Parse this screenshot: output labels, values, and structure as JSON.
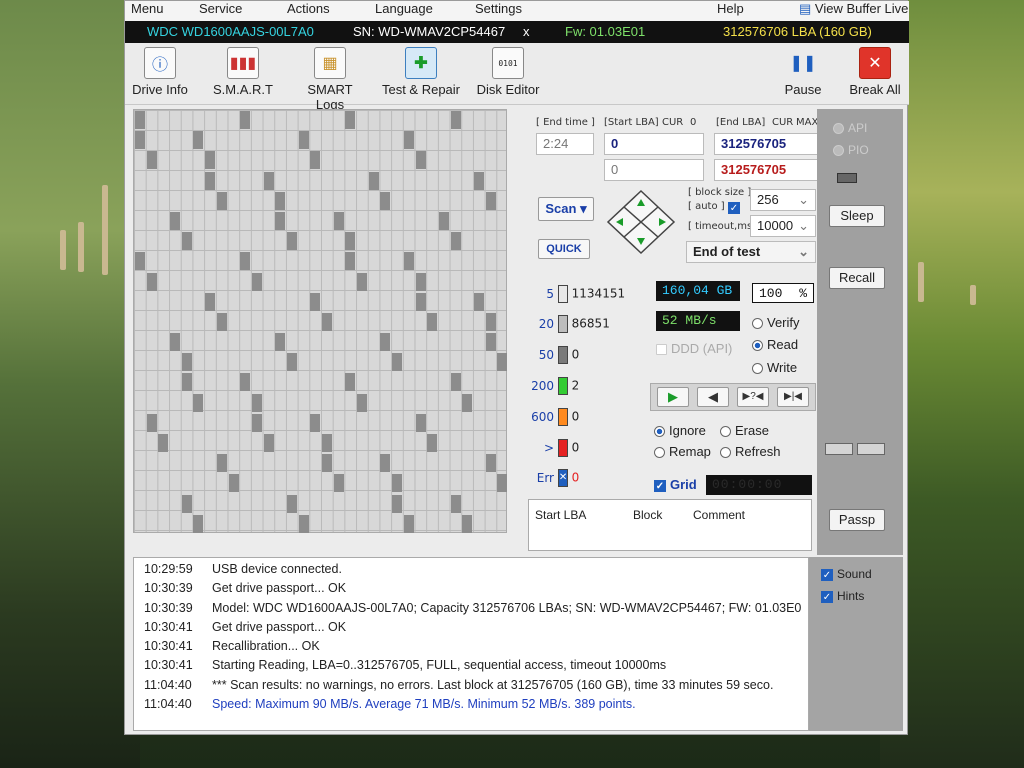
{
  "menu": {
    "items": [
      "Menu",
      "Service",
      "Actions",
      "Language",
      "Settings",
      "Help"
    ],
    "view_buffer": "View Buffer Live"
  },
  "drive": {
    "model": "WDC WD1600AAJS-00L7A0",
    "serial": "SN: WD-WMAV2CP54467",
    "close": "x",
    "firmware": "Fw: 01.03E01",
    "capacity": "312576706 LBA (160 GB)"
  },
  "toolbar": {
    "drive_info": "Drive Info",
    "smart": "S.M.A.R.T",
    "smart_logs": "SMART Logs",
    "test_repair": "Test & Repair",
    "disk_editor": "Disk Editor",
    "pause": "Pause",
    "break_all": "Break All"
  },
  "controls": {
    "end_time_label": "[ End time ]",
    "end_time_value": "2:24",
    "start_lba_label": "[Start LBA]",
    "cur_label": "CUR",
    "cur_value": "0",
    "end_lba_label": "[End LBA]",
    "cur2_label": "CUR",
    "max_label": "MAX",
    "start_lba_value": "0",
    "start_lba_value2": "0",
    "end_lba_value": "312576705",
    "end_lba_value2": "312576705",
    "scan_button": "Scan",
    "quick_button": "QUICK",
    "block_size_label": "[ block size ]",
    "auto_label": "[ auto ]",
    "block_size_value": "256",
    "timeout_label": "[ timeout,ms ]",
    "timeout_value": "10000",
    "end_action": "End of test"
  },
  "stats": {
    "rows": [
      {
        "label": "5",
        "count": "1134151",
        "color": "#e8e8e8"
      },
      {
        "label": "20",
        "count": "86851",
        "color": "#bdbdbd"
      },
      {
        "label": "50",
        "count": "0",
        "color": "#7a7a7a"
      },
      {
        "label": "200",
        "count": "2",
        "color": "#33cc33"
      },
      {
        "label": "600",
        "count": "0",
        "color": "#ff8a1f"
      },
      {
        "label": ">",
        "count": "0",
        "color": "#e52222"
      },
      {
        "label": "Err",
        "count": "0",
        "color": "#1f5fbf"
      }
    ],
    "size": "160,04 GB",
    "percent": "100",
    "percent_sign": "%",
    "speed": "52 MB/s",
    "ddd": "DDD (API)",
    "verify": "Verify",
    "read": "Read",
    "write": "Write",
    "ignore": "Ignore",
    "erase": "Erase",
    "remap": "Remap",
    "refresh": "Refresh",
    "grid": "Grid",
    "timer": "00:00:00"
  },
  "block_list": {
    "start_lba": "Start LBA",
    "block": "Block",
    "comment": "Comment"
  },
  "side": {
    "api": "API",
    "pio": "PIO",
    "sleep": "Sleep",
    "recall": "Recall",
    "passp": "Passp",
    "sound": "Sound",
    "hints": "Hints"
  },
  "log": [
    {
      "time": "10:29:59",
      "text": "USB device connected.",
      "color": "#222"
    },
    {
      "time": "10:30:39",
      "text": "Get drive passport... OK",
      "color": "#222"
    },
    {
      "time": "10:30:39",
      "text": "Model: WDC WD1600AAJS-00L7A0; Capacity 312576706 LBAs; SN: WD-WMAV2CP54467; FW: 01.03E0",
      "color": "#222"
    },
    {
      "time": "10:30:41",
      "text": "Get drive passport... OK",
      "color": "#222"
    },
    {
      "time": "10:30:41",
      "text": "Recallibration... OK",
      "color": "#222"
    },
    {
      "time": "10:30:41",
      "text": "Starting Reading, LBA=0..312576705, FULL, sequential access, timeout 10000ms",
      "color": "#222"
    },
    {
      "time": "11:04:40",
      "text": "*** Scan results: no warnings, no errors. Last block at 312576705 (160 GB), time 33 minutes 59 seco.",
      "color": "#222"
    },
    {
      "time": "11:04:40",
      "text": "Speed: Maximum 90 MB/s. Average 71 MB/s. Minimum 52 MB/s. 389 points.",
      "color": "#1f3fbf"
    }
  ]
}
